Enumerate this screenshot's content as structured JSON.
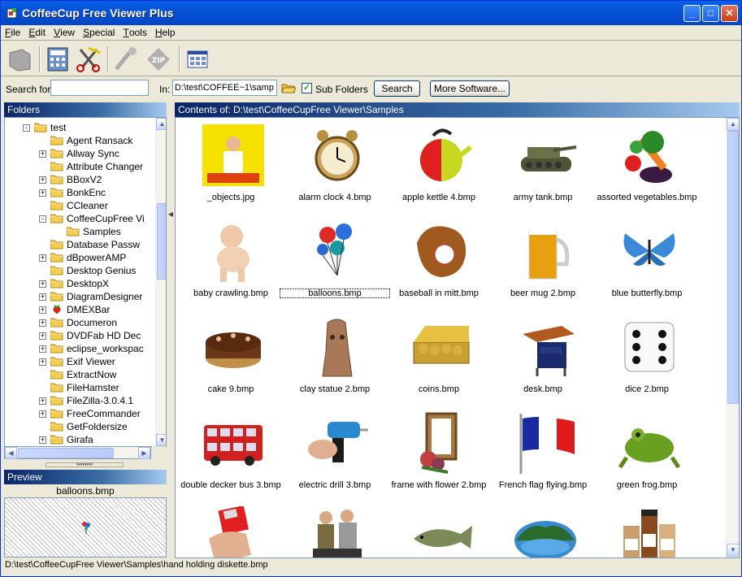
{
  "window": {
    "title": "CoffeeCup Free Viewer Plus"
  },
  "menu": [
    "File",
    "Edit",
    "View",
    "Special",
    "Tools",
    "Help"
  ],
  "menu_underline": [
    "F",
    "E",
    "V",
    "S",
    "T",
    "H"
  ],
  "search": {
    "label": "Search for:",
    "value": "",
    "in_label": "In:",
    "in_value": "D:\\test\\COFFEE~1\\samp",
    "subfolders_label": "Sub Folders",
    "subfolders_checked": true,
    "search_button": "Search",
    "more_button": "More Software..."
  },
  "folders": {
    "title": "Folders",
    "items": [
      {
        "label": "test",
        "level": 0,
        "expanded": true,
        "toggle": "-"
      },
      {
        "label": "Agent Ransack",
        "level": 1,
        "toggle": ""
      },
      {
        "label": "Allway Sync",
        "level": 1,
        "toggle": "+"
      },
      {
        "label": "Attribute Changer",
        "level": 1,
        "toggle": ""
      },
      {
        "label": "BBoxV2",
        "level": 1,
        "toggle": "+"
      },
      {
        "label": "BonkEnc",
        "level": 1,
        "toggle": "+"
      },
      {
        "label": "CCleaner",
        "level": 1,
        "toggle": ""
      },
      {
        "label": "CoffeeCupFree Vi",
        "level": 1,
        "toggle": "-"
      },
      {
        "label": "Samples",
        "level": 2,
        "toggle": ""
      },
      {
        "label": "Database Passw",
        "level": 1,
        "toggle": ""
      },
      {
        "label": "dBpowerAMP",
        "level": 1,
        "toggle": "+"
      },
      {
        "label": "Desktop Genius",
        "level": 1,
        "toggle": ""
      },
      {
        "label": "DesktopX",
        "level": 1,
        "toggle": "+"
      },
      {
        "label": "DiagramDesigner",
        "level": 1,
        "toggle": "+"
      },
      {
        "label": "DMEXBar",
        "level": 1,
        "toggle": "+",
        "special": true
      },
      {
        "label": "Documeron",
        "level": 1,
        "toggle": "+"
      },
      {
        "label": "DVDFab HD Dec",
        "level": 1,
        "toggle": "+"
      },
      {
        "label": "eclipse_workspac",
        "level": 1,
        "toggle": "+"
      },
      {
        "label": "Exif Viewer",
        "level": 1,
        "toggle": "+"
      },
      {
        "label": "ExtractNow",
        "level": 1,
        "toggle": ""
      },
      {
        "label": "FileHamster",
        "level": 1,
        "toggle": ""
      },
      {
        "label": "FileZilla-3.0.4.1",
        "level": 1,
        "toggle": "+"
      },
      {
        "label": "FreeCommander",
        "level": 1,
        "toggle": "+"
      },
      {
        "label": "GetFoldersize",
        "level": 1,
        "toggle": ""
      },
      {
        "label": "Girafa",
        "level": 1,
        "toggle": "+"
      }
    ]
  },
  "preview": {
    "title": "Preview",
    "filename": "balloons.bmp"
  },
  "contents": {
    "title": "Contents of:  D:\\test\\CoffeeCupFree Viewer\\Samples",
    "files": [
      {
        "name": "_objects.jpg",
        "icon": "objects-ad-thumb"
      },
      {
        "name": "alarm clock 4.bmp",
        "icon": "alarm-clock-thumb"
      },
      {
        "name": "apple kettle 4.bmp",
        "icon": "apple-kettle-thumb"
      },
      {
        "name": "army tank.bmp",
        "icon": "army-tank-thumb"
      },
      {
        "name": "assorted vegetables.bmp",
        "icon": "vegetables-thumb"
      },
      {
        "name": "baby crawling.bmp",
        "icon": "baby-thumb"
      },
      {
        "name": "balloons.bmp",
        "icon": "balloons-thumb",
        "selected": true
      },
      {
        "name": "baseball in mitt.bmp",
        "icon": "baseball-mitt-thumb"
      },
      {
        "name": "beer mug 2.bmp",
        "icon": "beer-mug-thumb"
      },
      {
        "name": "blue butterfly.bmp",
        "icon": "butterfly-thumb"
      },
      {
        "name": "cake 9.bmp",
        "icon": "cake-thumb"
      },
      {
        "name": "clay statue 2.bmp",
        "icon": "clay-statue-thumb"
      },
      {
        "name": "coins.bmp",
        "icon": "coins-thumb"
      },
      {
        "name": "desk.bmp",
        "icon": "desk-thumb"
      },
      {
        "name": "dice 2.bmp",
        "icon": "dice-thumb"
      },
      {
        "name": "double decker bus 3.bmp",
        "icon": "bus-thumb"
      },
      {
        "name": "electric drill 3.bmp",
        "icon": "drill-thumb"
      },
      {
        "name": "frame with flower 2.bmp",
        "icon": "frame-thumb"
      },
      {
        "name": "French flag flying.bmp",
        "icon": "flag-thumb"
      },
      {
        "name": "green frog.bmp",
        "icon": "frog-thumb"
      },
      {
        "name": "",
        "icon": "diskette-hand-thumb"
      },
      {
        "name": "",
        "icon": "people-thumb"
      },
      {
        "name": "",
        "icon": "fish-thumb"
      },
      {
        "name": "",
        "icon": "lake-thumb"
      },
      {
        "name": "",
        "icon": "bottles-thumb"
      }
    ]
  },
  "status": {
    "text": "D:\\test\\CoffeeCupFree Viewer\\Samples\\hand holding diskette.bmp"
  }
}
